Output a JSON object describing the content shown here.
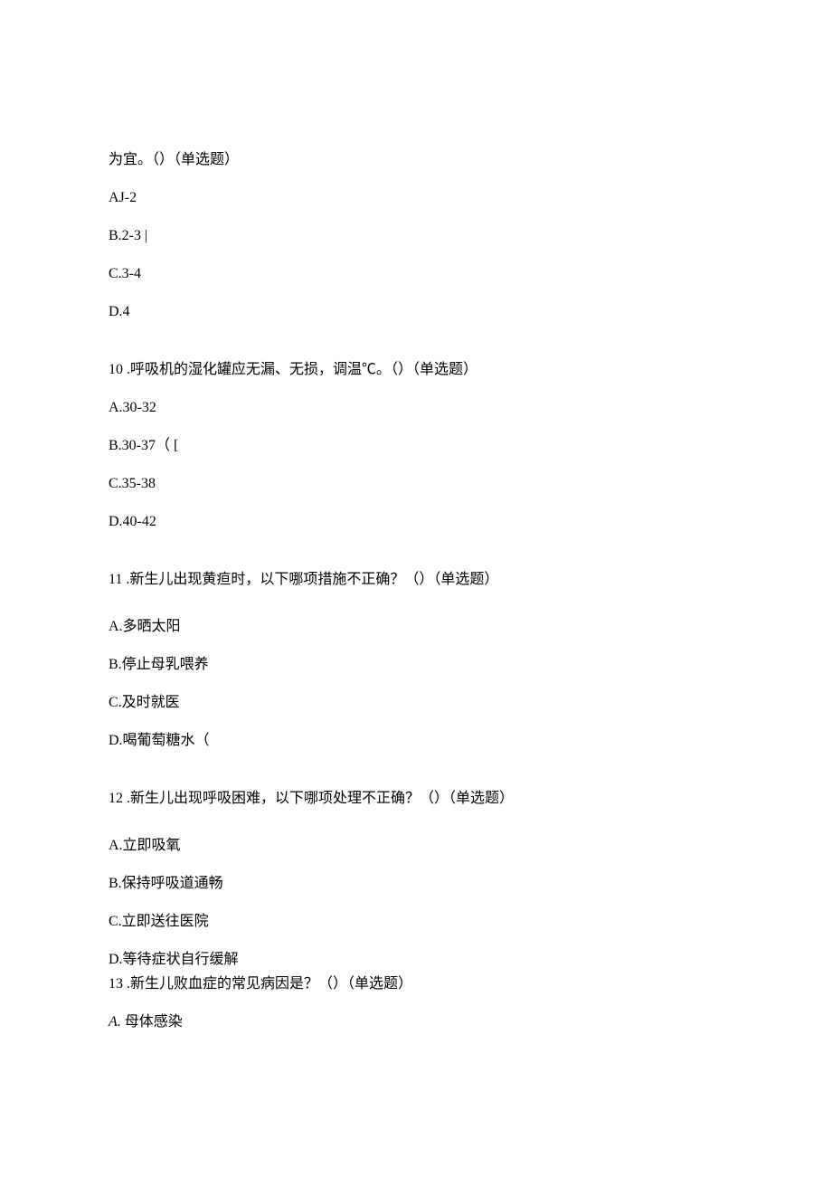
{
  "q9": {
    "stem_tail": "为宜。（）（单选题）",
    "opts": {
      "a": "AJ-2",
      "b": "B.2-3 |",
      "c": "C.3-4",
      "d": "D.4"
    }
  },
  "q10": {
    "stem": "10 .呼吸机的湿化罐应无漏、无损，调温℃。（）（单选题）",
    "opts": {
      "a": "A.30-32",
      "b": "B.30-37（ [",
      "c": "C.35-38",
      "d": "D.40-42"
    }
  },
  "q11": {
    "stem": "11 .新生儿出现黄疸时，以下哪项措施不正确？（）（单选题）",
    "opts": {
      "a": "A.多晒太阳",
      "b": "B.停止母乳喂养",
      "c": "C.及时就医",
      "d": "D.喝葡萄糖水（"
    }
  },
  "q12": {
    "stem": "12 .新生儿出现呼吸困难，以下哪项处理不正确？（）（单选题）",
    "opts": {
      "a": "A.立即吸氧",
      "b": "B.保持呼吸道通畅",
      "c": "C.立即送往医院",
      "d": "D.等待症状自行缓解"
    }
  },
  "q13": {
    "stem": "13 .新生儿败血症的常见病因是？（）（单选题）",
    "opts": {
      "a_prefix": "A.",
      "a_text": " 母体感染"
    }
  }
}
